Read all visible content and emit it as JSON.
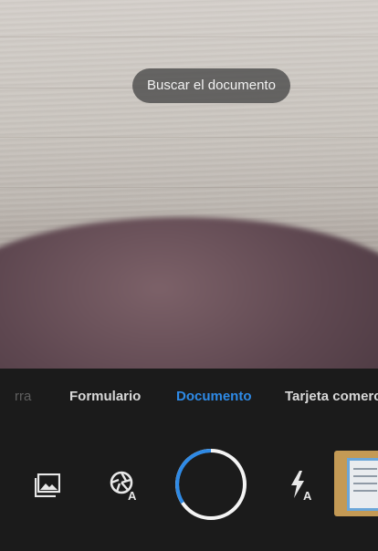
{
  "toast": {
    "text": "Buscar el documento"
  },
  "modes": [
    {
      "label": "rra",
      "state": "partial"
    },
    {
      "label": "Formulario",
      "state": "inactive"
    },
    {
      "label": "Documento",
      "state": "active"
    },
    {
      "label": "Tarjeta comercia",
      "state": "partial"
    }
  ],
  "controls": {
    "gallery_icon": "image-gallery-icon",
    "auto_capture_icon": "auto-capture-aperture-icon",
    "auto_capture_badge": "A",
    "flash_icon": "flash-auto-icon",
    "flash_badge": "A",
    "shutter_icon": "shutter-button",
    "thumbnail": "scanned-document-thumbnail"
  },
  "colors": {
    "accent": "#2e8ae6",
    "panel": "#1b1b1b",
    "toast_bg": "#464646"
  }
}
